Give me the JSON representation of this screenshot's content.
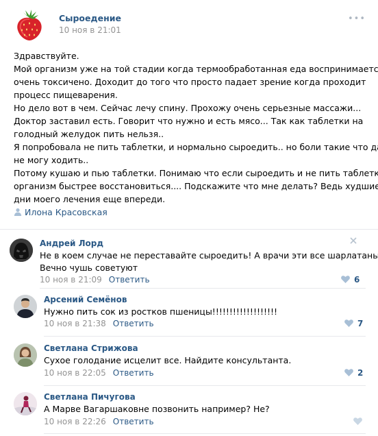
{
  "post": {
    "group_name": "Сыроедение",
    "time": "10 ноя в 21:01",
    "lines": [
      "Здравствуйте.",
      "Мой организм уже на той стадии когда термообработанная еда воспринимается",
      "очень токсичено. Доходит до того что просто падает зрение когда проходит",
      "процесс пищеварения.",
      "Но дело вот в чем. Сейчас лечу спину. Прохожу очень серьезные массажи...",
      "Доктор заставил есть. Говорит что нужно и есть мясо... Так как таблетки на",
      "голодный желудок пить нельзя..",
      "Я попробовала не пить таблетки, и нормально сыроедить.. но боли такие что даже",
      "не могу ходить..",
      "Потому кушаю и пью таблетки. Понимаю что если сыроедить и не пить таблетки",
      "организм быстрее восстановиться.... Подскажите что мне делать? Ведь худшие",
      "дни моего лечения еще впереди."
    ],
    "signer": "Илона Красовская"
  },
  "comments": [
    {
      "author": "Андрей Лорд",
      "lines": [
        "Не в коем случае не переставайте сыроедить! А врачи эти все шарлатаны!",
        "Вечно чушь советуют"
      ],
      "time": "10 ноя в 21:09",
      "reply": "Ответить",
      "likes": "6"
    },
    {
      "author": "Арсений Семёнов",
      "lines": [
        "Нужно пить сок из ростков пшеницы!!!!!!!!!!!!!!!!!!!"
      ],
      "time": "10 ноя в 21:38",
      "reply": "Ответить",
      "likes": "7"
    },
    {
      "author": "Светлана Стрижова",
      "lines": [
        "Сухое голодание исцелит все. Найдите консультанта."
      ],
      "time": "10 ноя в 22:05",
      "reply": "Ответить",
      "likes": "2"
    },
    {
      "author": "Светлана Пичугова",
      "lines": [
        "А Марве Вагаршаковне позвонить например? Не?"
      ],
      "time": "10 ноя в 22:26",
      "reply": "Ответить",
      "likes": ""
    }
  ],
  "icons": {
    "more": "more-dots-icon",
    "person": "person-icon",
    "like": "heart-icon",
    "close": "close-icon"
  },
  "colors": {
    "link": "#2a5885",
    "meta": "#939393",
    "divider": "#e7e8ec",
    "like_icon": "#a8bfd6"
  }
}
